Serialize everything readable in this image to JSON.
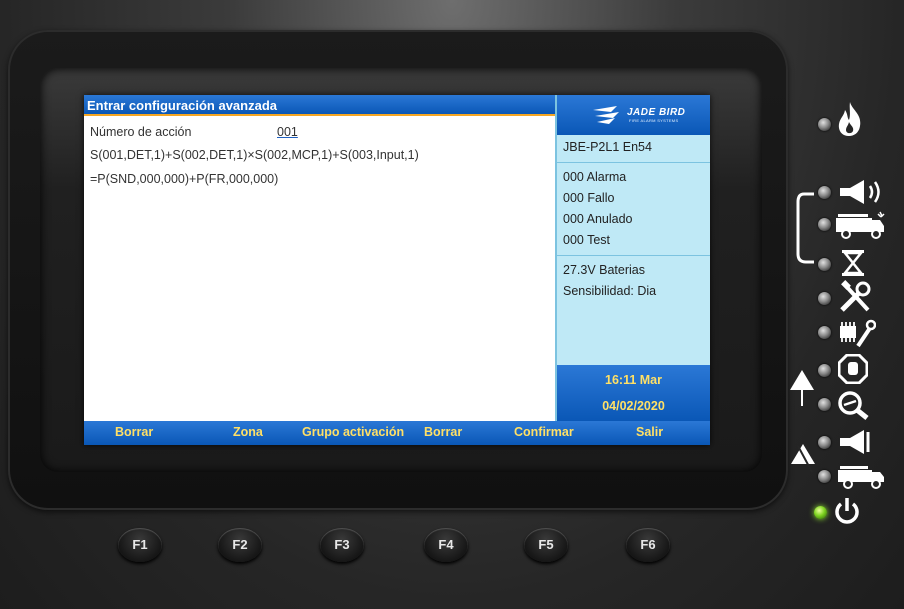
{
  "screen": {
    "title": "Entrar configuración avanzada",
    "action_label": "Número de acción",
    "action_value": "001",
    "expression_line1": "S(001,DET,1)+S(002,DET,1)×S(002,MCP,1)+S(003,Input,1)",
    "expression_line2": "=P(SND,000,000)+P(FR,000,000)"
  },
  "side_panel": {
    "logo_text": "JADE BIRD",
    "logo_subtext": "FIRE ALARM SYSTEMS",
    "model": "JBE-P2L1 En54",
    "counts": [
      "000 Alarma",
      "000 Fallo",
      "000 Anulado",
      "000 Test"
    ],
    "status": [
      "27.3V Baterias",
      "Sensibilidad:  Dia"
    ],
    "time": "16:11 Mar",
    "date": "04/02/2020"
  },
  "softkeys": [
    "Borrar",
    "Zona",
    "Grupo activación",
    "Borrar",
    "Confirmar",
    "Salir"
  ],
  "hardware_buttons": [
    "F1",
    "F2",
    "F3",
    "F4",
    "F5",
    "F6"
  ],
  "indicators": [
    "fire-icon",
    "sounder-icon",
    "fire-truck-icon",
    "delay-hourglass-icon",
    "fault-tools-icon",
    "system-fault-icon",
    "disabled-hand-icon",
    "test-magnifier-icon",
    "sounder-fault-icon",
    "fire-routing-fault-icon",
    "power-icon"
  ],
  "colors": {
    "title_blue": "#0a57b6",
    "softkey_yellow": "#ffe066",
    "side_cyan": "#bfe9f6",
    "power_led": "#7ed321"
  }
}
